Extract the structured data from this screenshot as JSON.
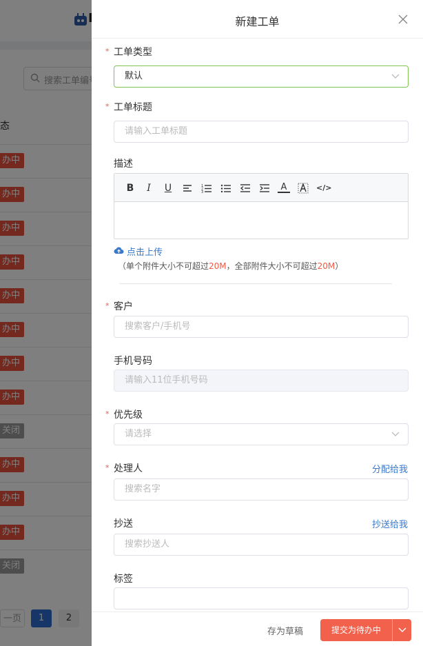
{
  "background": {
    "app_logo_text": "I",
    "search_placeholder": "搜索工单编号",
    "column_header": "态",
    "badges": [
      {
        "text": "办中",
        "status": "red"
      },
      {
        "text": "办中",
        "status": "red"
      },
      {
        "text": "办中",
        "status": "red"
      },
      {
        "text": "办中",
        "status": "red"
      },
      {
        "text": "办中",
        "status": "red"
      },
      {
        "text": "办中",
        "status": "red"
      },
      {
        "text": "办中",
        "status": "red"
      },
      {
        "text": "办中",
        "status": "red"
      },
      {
        "text": "关闭",
        "status": "gray"
      },
      {
        "text": "办中",
        "status": "red"
      },
      {
        "text": "办中",
        "status": "red"
      },
      {
        "text": "办中",
        "status": "red"
      },
      {
        "text": "关闭",
        "status": "gray"
      }
    ],
    "pager": {
      "prev": "一页",
      "page1": "1",
      "page2": "2"
    }
  },
  "drawer": {
    "title": "新建工单",
    "required_mark": "*",
    "fields": {
      "type": {
        "label": "工单类型",
        "value": "默认"
      },
      "title": {
        "label": "工单标题",
        "placeholder": "请输入工单标题"
      },
      "desc": {
        "label": "描述"
      },
      "customer": {
        "label": "客户",
        "placeholder": "搜索客户/手机号"
      },
      "phone": {
        "label": "手机号码",
        "placeholder": "请输入11位手机号码"
      },
      "priority": {
        "label": "优先级",
        "placeholder": "请选择"
      },
      "handler": {
        "label": "处理人",
        "placeholder": "搜索名字",
        "link": "分配给我"
      },
      "cc": {
        "label": "抄送",
        "placeholder": "搜索抄送人",
        "link": "抄送给我"
      },
      "tags": {
        "label": "标签"
      }
    },
    "toolbar": {
      "bold": "B",
      "italic": "I",
      "underline": "U",
      "font_color": "A",
      "code": "</>"
    },
    "upload": {
      "label": "点击上传",
      "hint_prefix": "（单个附件大小不可超过",
      "hint_size1": "20M",
      "hint_mid": "，全部附件大小不可超过",
      "hint_size2": "20M",
      "hint_suffix": "）"
    },
    "footer": {
      "draft": "存为草稿",
      "submit": "提交为待办中"
    }
  },
  "colors": {
    "accent": "#f1614c",
    "link": "#3a78c9",
    "active_border": "#7ec252",
    "required": "#f05a47"
  }
}
